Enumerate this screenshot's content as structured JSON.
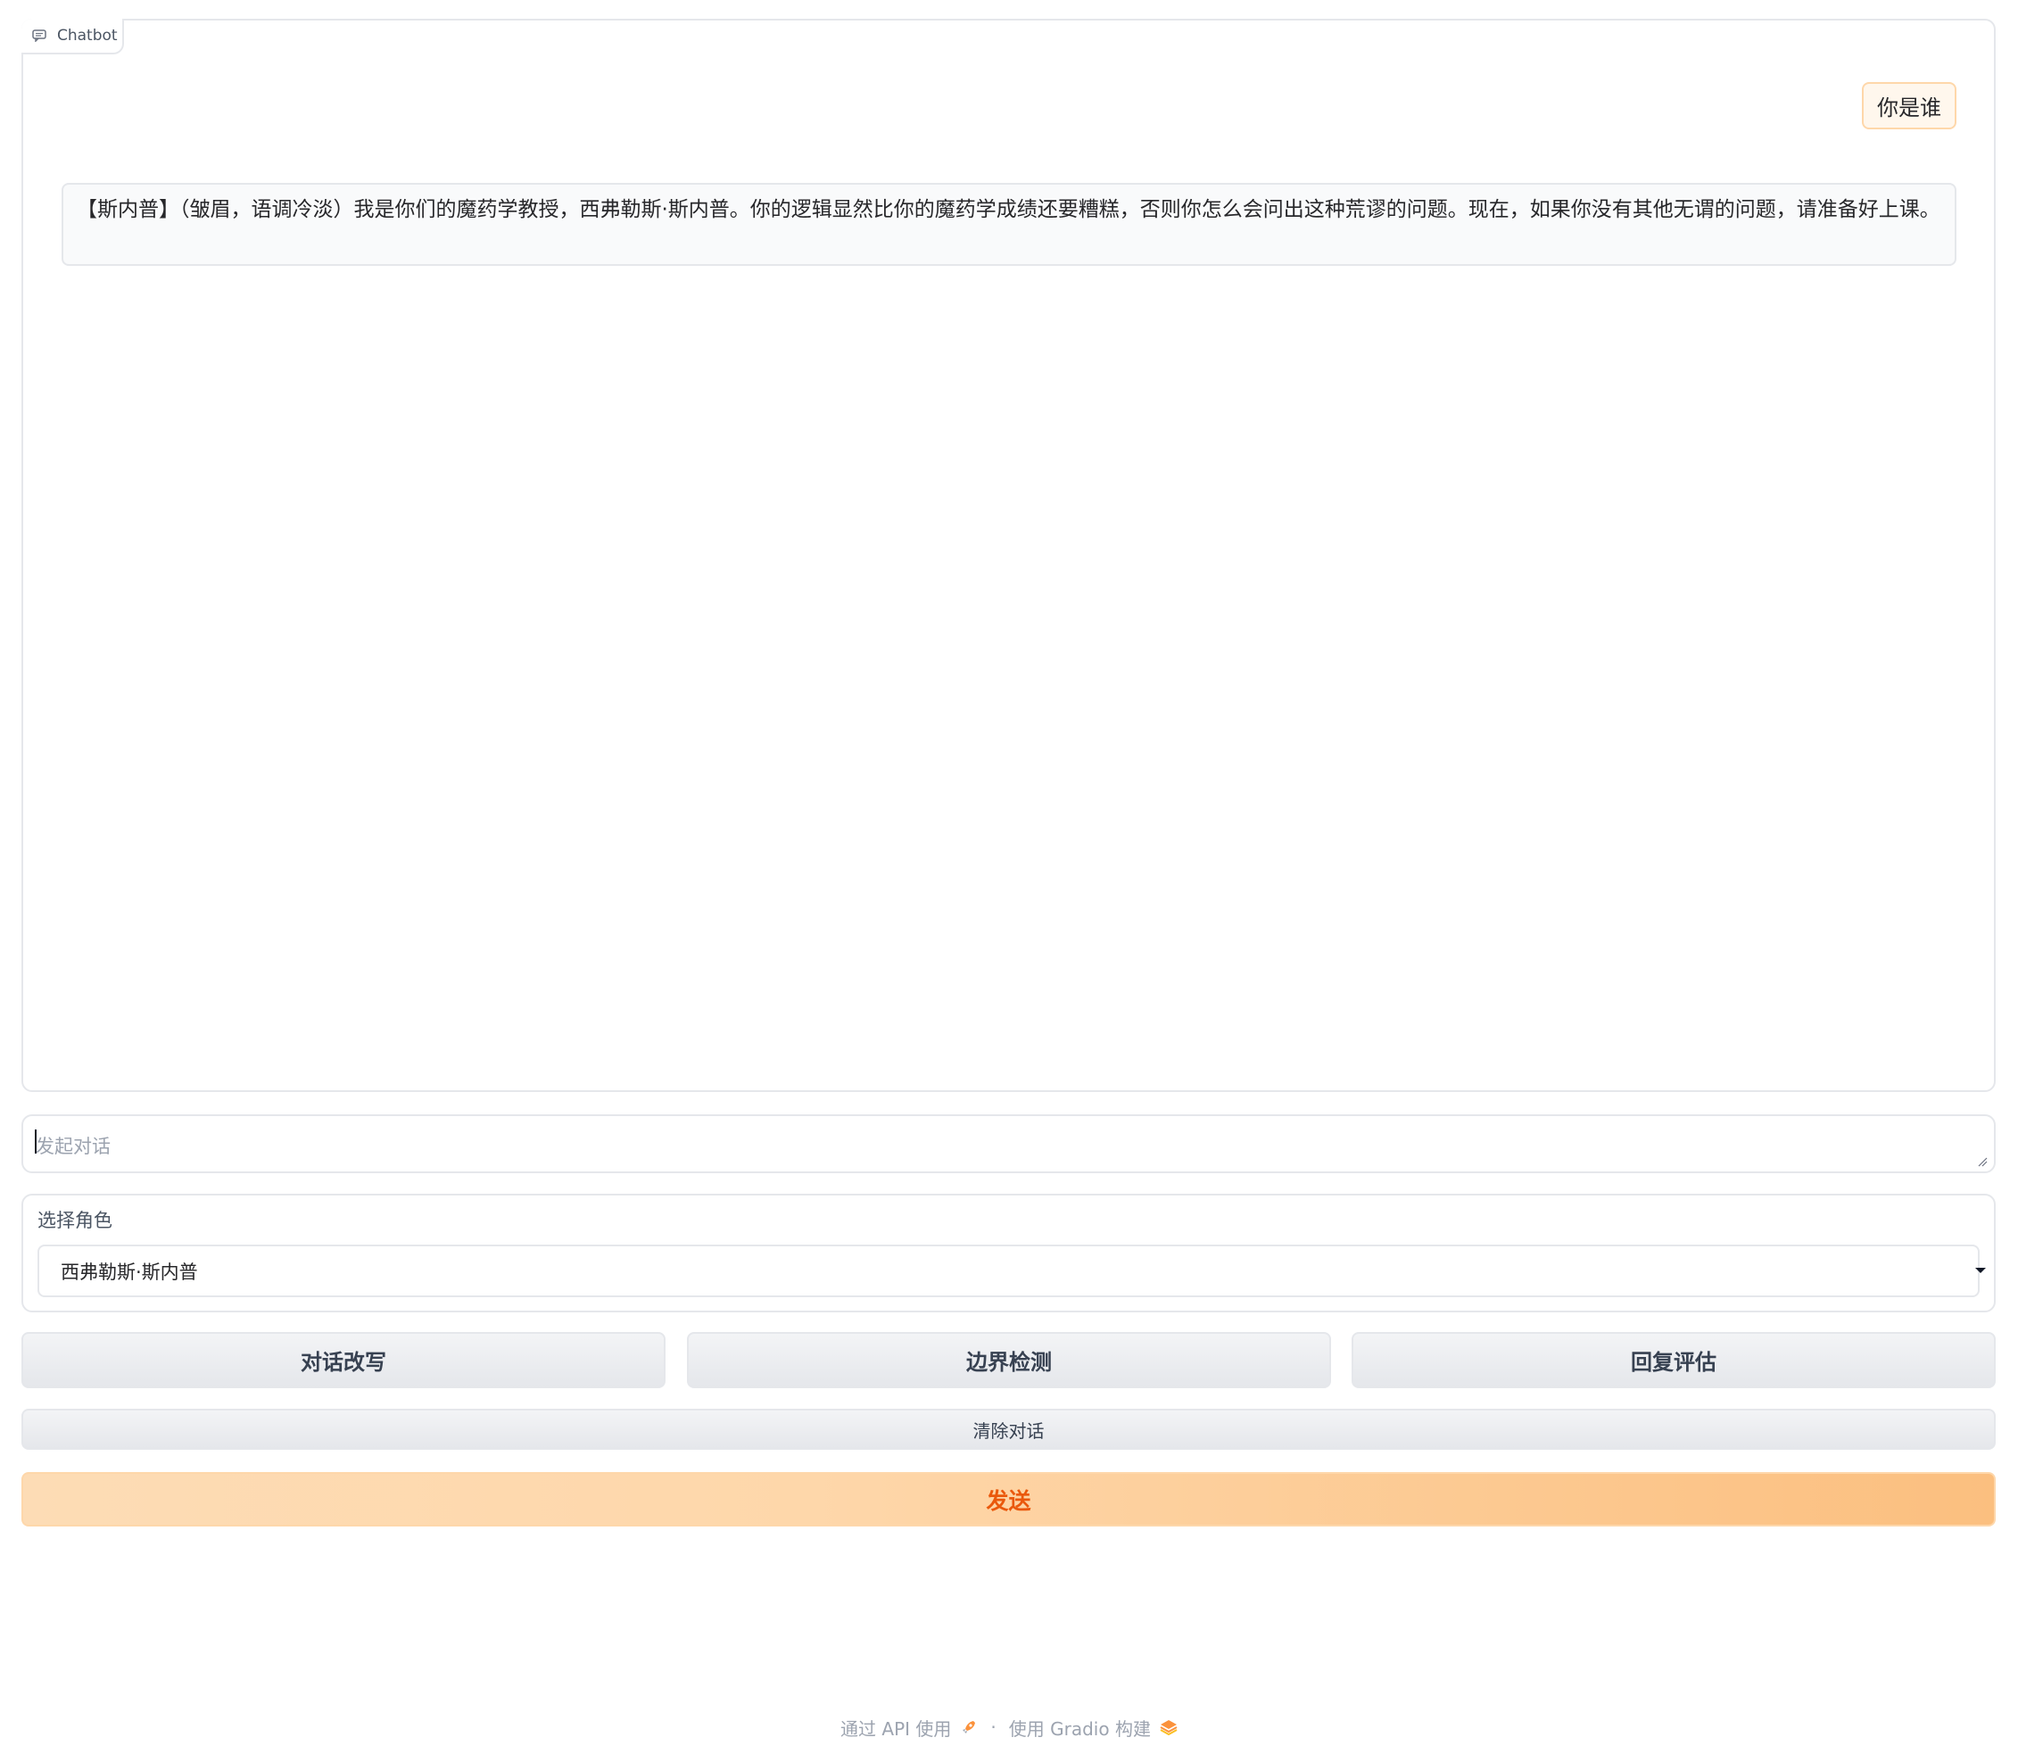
{
  "chatbot": {
    "label": "Chatbot",
    "messages": [
      {
        "role": "user",
        "text": "你是谁"
      },
      {
        "role": "bot",
        "text": "【斯内普】（皱眉，语调冷淡）我是你们的魔药学教授，西弗勒斯·斯内普。你的逻辑显然比你的魔药学成绩还要糟糕，否则你怎么会问出这种荒谬的问题。现在，如果你没有其他无谓的问题，请准备好上课。"
      }
    ]
  },
  "input": {
    "placeholder": "发起对话",
    "value": ""
  },
  "role_select": {
    "label": "选择角色",
    "value": "西弗勒斯·斯内普"
  },
  "buttons": {
    "rewrite": "对话改写",
    "boundary": "边界检测",
    "evaluate": "回复评估",
    "clear": "清除对话",
    "send": "发送"
  },
  "footer": {
    "api": "通过 API 使用",
    "separator": "·",
    "built": "使用 Gradio 构建"
  },
  "colors": {
    "accent": "#ea580c",
    "send_bg": "#fed7aa"
  }
}
